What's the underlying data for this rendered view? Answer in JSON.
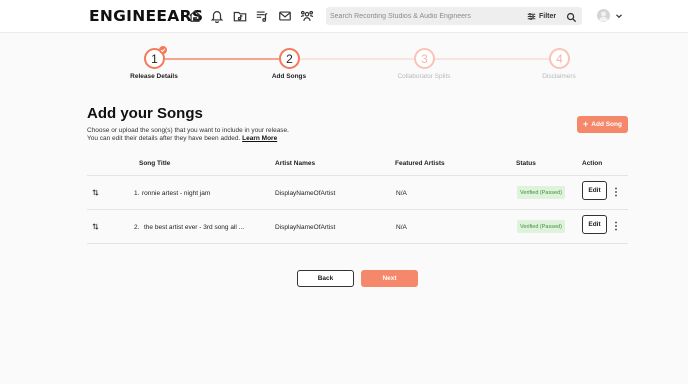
{
  "header": {
    "logo_text": "ENGINEEARS",
    "nav_icons": [
      "home-icon",
      "bell-icon",
      "folder-music-icon",
      "playlist-icon",
      "mail-icon",
      "community-icon"
    ],
    "search_placeholder": "Search Recording Studios & Audio Engineers",
    "filter_label": "Filter"
  },
  "stepper": {
    "steps": [
      {
        "number": "1",
        "label": "Release Details",
        "state": "completed"
      },
      {
        "number": "2",
        "label": "Add Songs",
        "state": "active"
      },
      {
        "number": "3",
        "label": "Collaborator Splits",
        "state": "inactive"
      },
      {
        "number": "4",
        "label": "Disclaimers",
        "state": "inactive"
      }
    ]
  },
  "main": {
    "title": "Add your Songs",
    "description_line1": "Choose or upload the song(s) that you want to include in your release.",
    "description_line2": "You can edit their details after they have been added.",
    "learn_more": "Learn More",
    "add_song_label": "Add Song"
  },
  "table": {
    "columns": [
      "Song Title",
      "Artist Names",
      "Featured Artists",
      "Status",
      "Action"
    ],
    "rows": [
      {
        "index": "1.",
        "title": "ronnie artest - night jam",
        "artist": "DisplayNameOfArtist",
        "featured": "N/A",
        "status": "Verified (Passed)",
        "action": "Edit"
      },
      {
        "index": "2.",
        "title": "the best artist ever - 3rd song all ...",
        "artist": "DisplayNameOfArtist",
        "featured": "N/A",
        "status": "Verified (Passed)",
        "action": "Edit"
      }
    ]
  },
  "footer": {
    "back_label": "Back",
    "next_label": "Next"
  },
  "colors": {
    "accent": "#f5876b",
    "status_green_bg": "#dff3dc",
    "status_green_text": "#3f8e3a"
  }
}
